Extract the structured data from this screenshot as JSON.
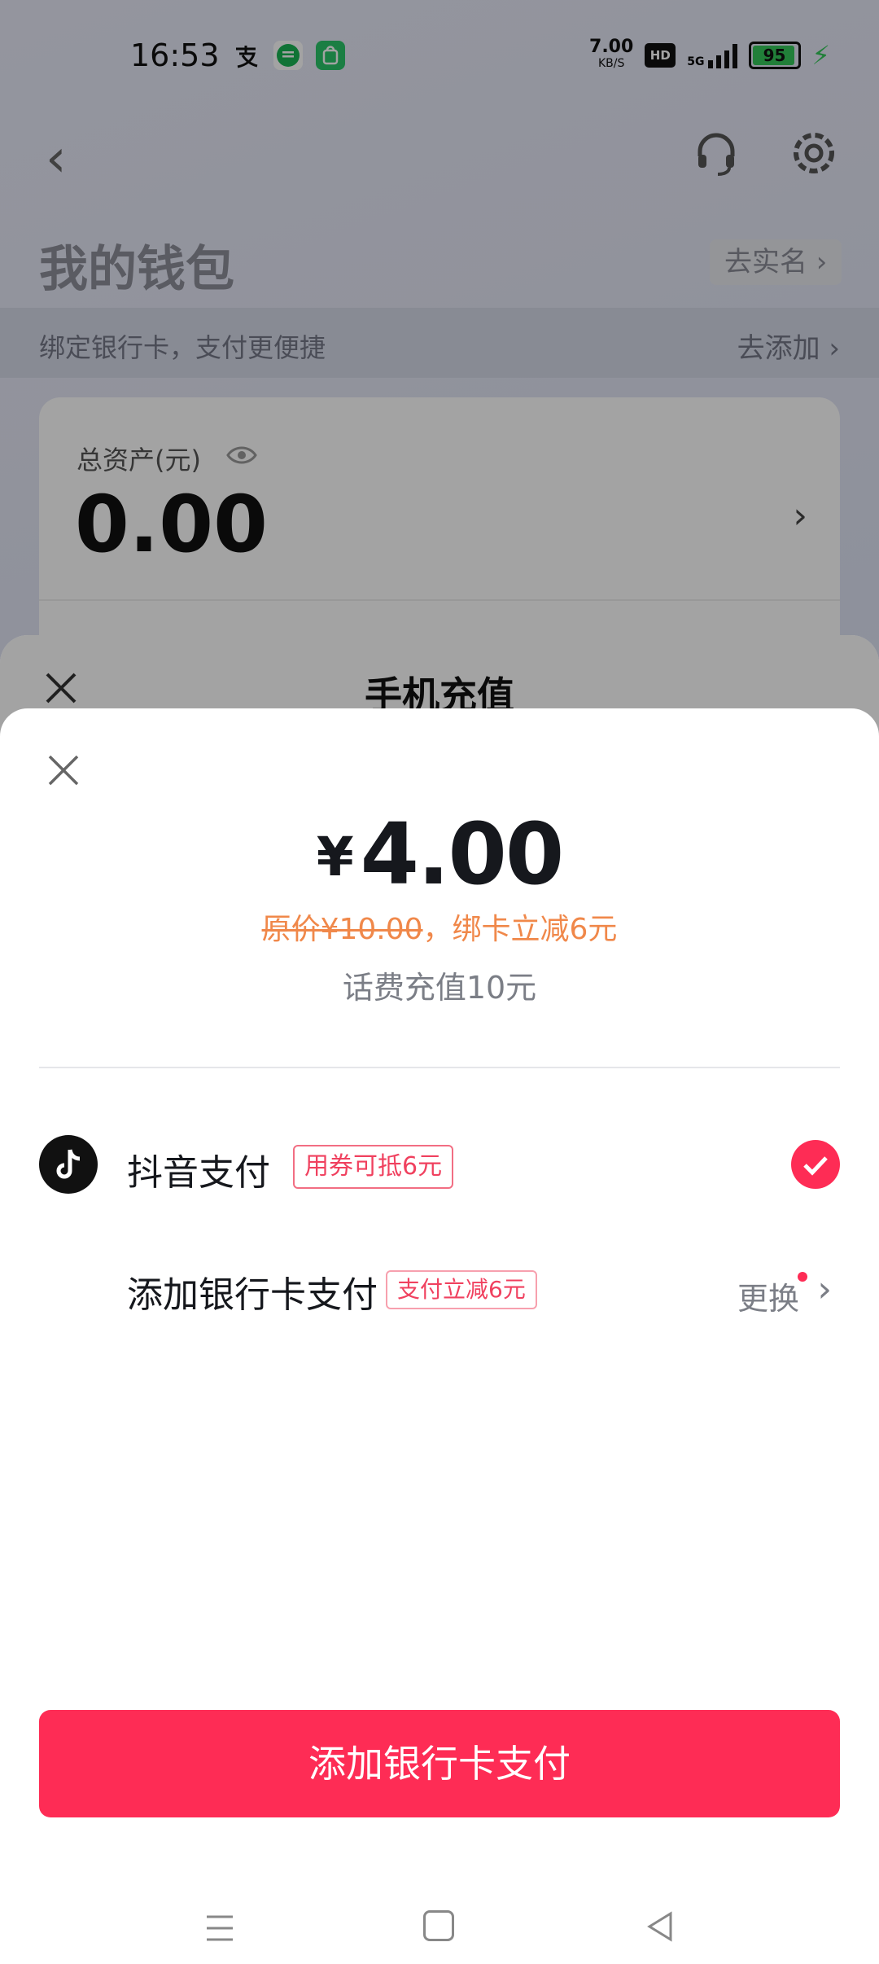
{
  "status_bar": {
    "time": "16:53",
    "net_speed": "7.00",
    "net_speed_unit": "KB/S",
    "hd": "HD",
    "network": "5G",
    "battery": "95",
    "battery_percent": 95,
    "colors": {
      "battery_fill": "#35c759"
    }
  },
  "wallet": {
    "title": "我的钱包",
    "realname_label": "去实名 ›",
    "bind_bar_text": "绑定银行卡，支付更便捷",
    "bind_bar_action": "去添加 ›",
    "asset_label": "总资产(元)",
    "asset_value": "0.00"
  },
  "recharge_sheet": {
    "title": "手机充值"
  },
  "payment_sheet": {
    "currency_symbol": "¥",
    "amount": "4.00",
    "original_price": "原价¥10.00",
    "discount_note": "，绑卡立减6元",
    "description": "话费充值10元",
    "options": [
      {
        "name": "抖音支付",
        "tag": "用券可抵6元",
        "selected": true
      },
      {
        "name": "添加银行卡支付",
        "tag": "支付立减6元",
        "action": "更换"
      }
    ],
    "confirm_button": "添加银行卡支付"
  },
  "colors": {
    "accent": "#fe2c55",
    "discount_text": "#f0884a"
  }
}
